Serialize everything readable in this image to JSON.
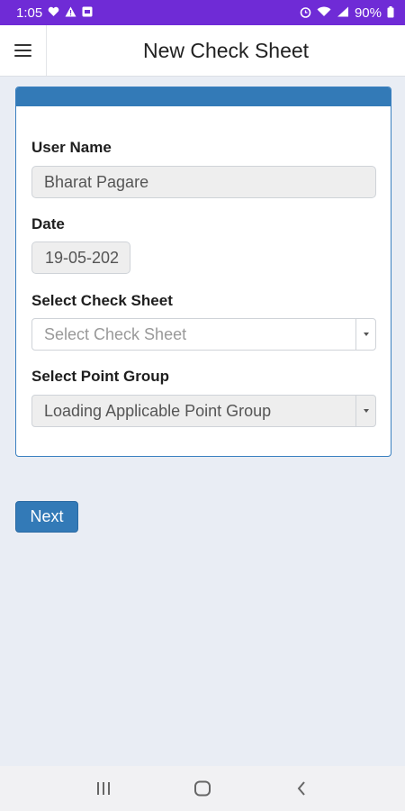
{
  "status_bar": {
    "time": "1:05",
    "battery": "90%",
    "left_icons": [
      "heart-icon",
      "warning-icon",
      "mail-icon"
    ],
    "right_icons": [
      "alarm-icon",
      "wifi-icon",
      "signal-icon",
      "battery-icon"
    ]
  },
  "app_bar": {
    "title": "New Check Sheet",
    "menu_icon": "hamburger-menu-icon"
  },
  "form": {
    "user_name_label": "User Name",
    "user_name_value": "Bharat Pagare",
    "date_label": "Date",
    "date_value": "19-05-202",
    "check_sheet_label": "Select Check Sheet",
    "check_sheet_placeholder": "Select Check Sheet",
    "point_group_label": "Select Point Group",
    "point_group_value": "Loading Applicable Point Group"
  },
  "actions": {
    "next_label": "Next"
  },
  "nav_bar": {
    "icons": [
      "recent-apps-icon",
      "home-icon",
      "back-icon"
    ]
  },
  "colors": {
    "status_bar": "#6f2bd6",
    "primary": "#337ab7",
    "background": "#e9edf4"
  }
}
